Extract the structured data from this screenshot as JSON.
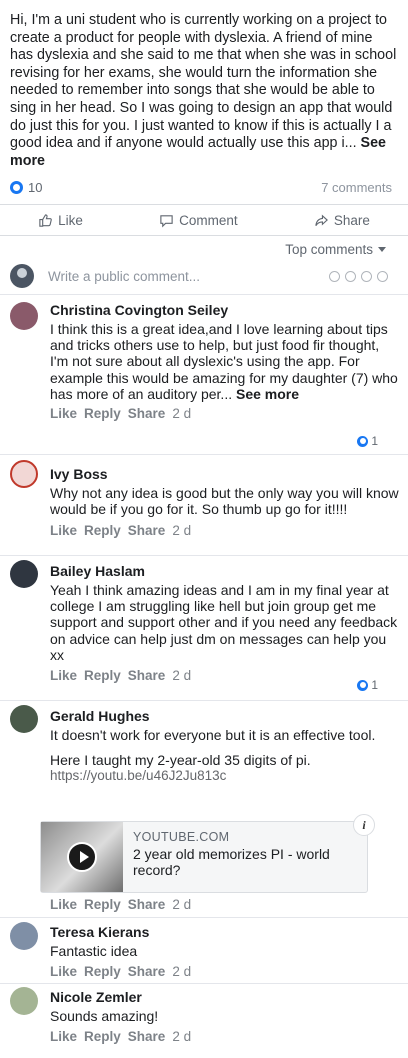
{
  "post": {
    "text": "Hi, I'm a uni student who is currently working on a project to create a product for people with dyslexia. A friend of mine has dyslexia and she said to me that when she was in school revising for her exams, she would turn the information she needed to remember into songs that she would be able to sing in her head. So I was going to design an app that would do just this for you. I just wanted to know if this is actually I a good idea and if anyone would actually use this app i...",
    "see_more": "See more",
    "like_count": "10",
    "comment_count": "7 comments"
  },
  "actions": {
    "like": "Like",
    "comment": "Comment",
    "share": "Share"
  },
  "filter": {
    "label": "Top comments"
  },
  "composer": {
    "placeholder": "Write a public comment..."
  },
  "comment_actions": {
    "like": "Like",
    "reply": "Reply",
    "share": "Share"
  },
  "comments": [
    {
      "name": "Christina Covington Seiley",
      "text": "I think this is a great idea,and I love learning about tips and tricks others use to help, but just food fir thought, I'm not sure about all dyslexic's using the app. For example this would be amazing for my daughter (7) who has more of an auditory per...",
      "see_more": "See more",
      "time": "2 d",
      "reactions": "1",
      "avatar_color": "#8a5a6a"
    },
    {
      "name": "Ivy Boss",
      "text": "Why not any idea is good but the only way you will know would be if you go for it. So thumb up go for it!!!!",
      "time": "2 d",
      "avatar_color": "#c0392b"
    },
    {
      "name": "Bailey Haslam",
      "text": "Yeah I think amazing ideas and I am in my final year at college I am struggling like hell but join group get me support and support other and if you need any feedback on advice can help just dm on messages can help you xx",
      "time": "2 d",
      "reactions": "1",
      "avatar_color": "#2f3640"
    },
    {
      "name": "Gerald Hughes",
      "text": "It doesn't work for everyone but it is an effective tool.",
      "text2": "Here I taught my 2-year-old 35 digits of pi.",
      "link": "https://youtu.be/u46J2Ju813c",
      "card": {
        "site": "YOUTUBE.COM",
        "title": "2 year old memorizes PI - world record?"
      },
      "time": "2 d",
      "avatar_color": "#4a5a4a"
    },
    {
      "name": "Teresa Kierans",
      "text": "Fantastic idea",
      "time": "2 d",
      "avatar_color": "#7f8fa6"
    },
    {
      "name": "Nicole Zemler",
      "text": "Sounds amazing!",
      "time": "2 d",
      "avatar_color": "#a4b494"
    }
  ],
  "colors": {
    "accent": "#1877f2",
    "meta": "#606770",
    "text": "#1c1e21"
  }
}
